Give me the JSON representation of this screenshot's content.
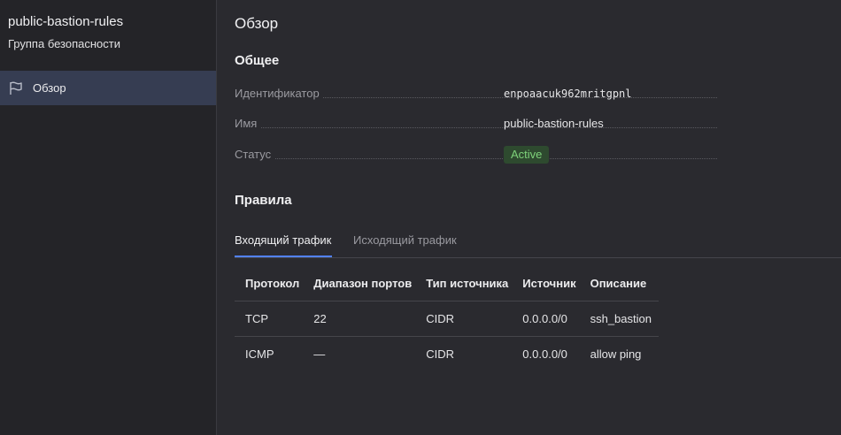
{
  "sidebar": {
    "title": "public-bastion-rules",
    "subtitle": "Группа безопасности",
    "items": [
      {
        "label": "Обзор",
        "icon": "flag-icon",
        "active": true
      }
    ]
  },
  "main": {
    "title": "Обзор",
    "general": {
      "heading": "Общее",
      "fields": [
        {
          "key": "Идентификатор",
          "value": "enpoaacuk962mritgpnl"
        },
        {
          "key": "Имя",
          "value": "public-bastion-rules"
        },
        {
          "key": "Статус",
          "value": "Active"
        }
      ]
    },
    "rules": {
      "heading": "Правила",
      "tabs": [
        {
          "label": "Входящий трафик",
          "active": true
        },
        {
          "label": "Исходящий трафик",
          "active": false
        }
      ],
      "columns": [
        "Протокол",
        "Диапазон портов",
        "Тип источника",
        "Источник",
        "Описание"
      ],
      "rows": [
        [
          "TCP",
          "22",
          "CIDR",
          "0.0.0.0/0",
          "ssh_bastion"
        ],
        [
          "ICMP",
          "—",
          "CIDR",
          "0.0.0.0/0",
          "allow ping"
        ]
      ]
    }
  },
  "colors": {
    "background": "#2a2a2f",
    "sidebar_bg": "#242428",
    "active_item_bg": "#363d52",
    "accent": "#5282ff",
    "status_green": "#7ed27a",
    "status_green_bg": "#2e4a2f"
  }
}
